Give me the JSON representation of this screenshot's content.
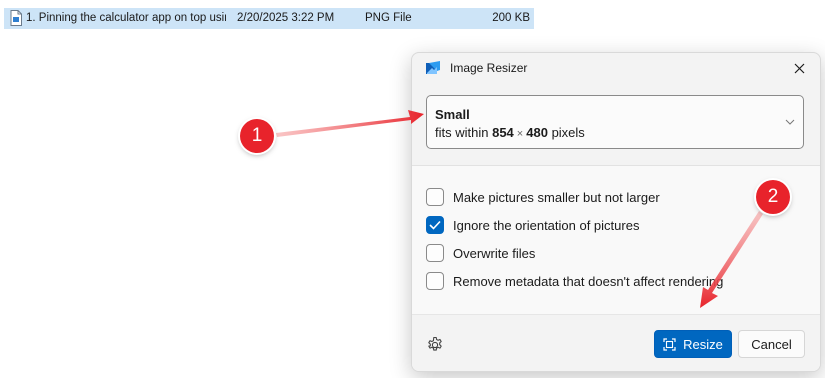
{
  "file": {
    "name": "1. Pinning the calculator app on top usin...",
    "date": "2/20/2025 3:22 PM",
    "type": "PNG File",
    "size": "200 KB"
  },
  "dialog": {
    "title": "Image Resizer",
    "size_select": {
      "name": "Small",
      "desc_prefix": "fits within",
      "width": "854",
      "times": "×",
      "height": "480",
      "unit": "pixels"
    },
    "options": [
      {
        "label": "Make pictures smaller but not larger",
        "checked": false
      },
      {
        "label": "Ignore the orientation of pictures",
        "checked": true
      },
      {
        "label": "Overwrite files",
        "checked": false
      },
      {
        "label": "Remove metadata that doesn't affect rendering",
        "checked": false
      }
    ],
    "resize_label": "Resize",
    "cancel_label": "Cancel"
  },
  "annotations": {
    "badge1": "1",
    "badge2": "2",
    "color": "#e8232b"
  },
  "colors": {
    "accent": "#0067c0",
    "selection": "#cde4f7"
  }
}
